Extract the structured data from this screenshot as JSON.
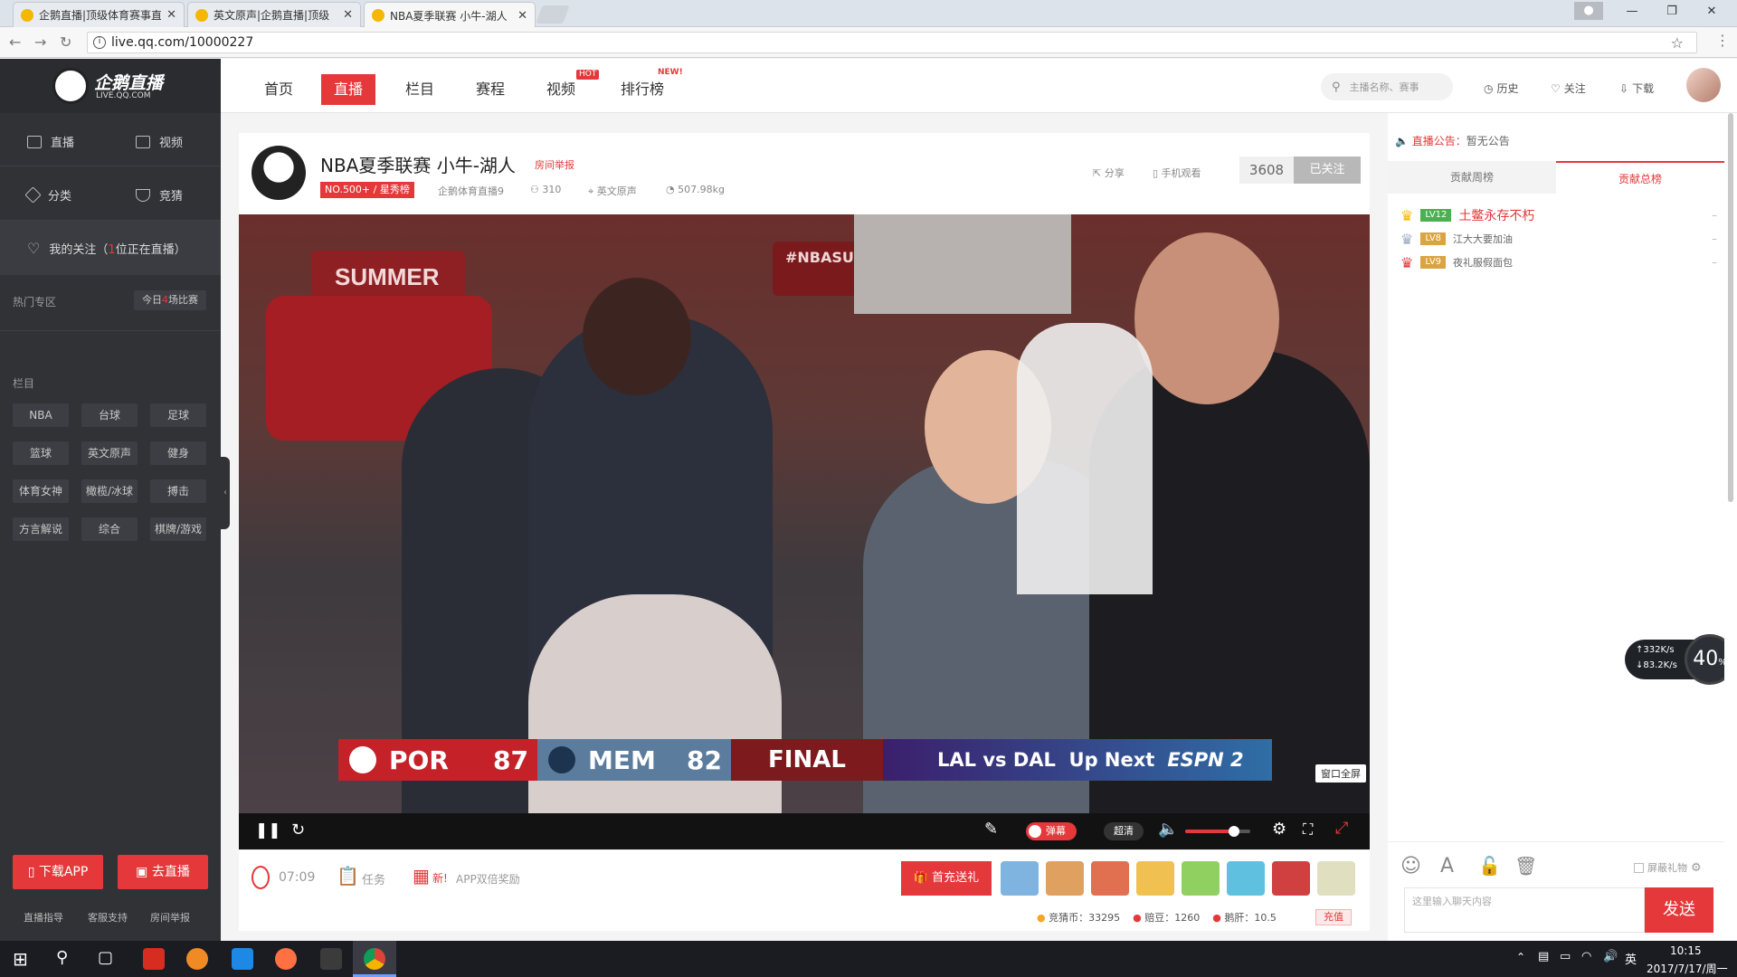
{
  "browser": {
    "tabs": [
      {
        "title": "企鹅直播|顶级体育赛事直"
      },
      {
        "title": "英文原声|企鹅直播|顶级"
      },
      {
        "title": "NBA夏季联赛 小牛-湖人"
      }
    ],
    "url": "live.qq.com/10000227"
  },
  "header": {
    "logo_text": "企鹅直播",
    "logo_sub": "LIVE.QQ.COM",
    "nav": [
      {
        "label": "首页"
      },
      {
        "label": "直播"
      },
      {
        "label": "栏目"
      },
      {
        "label": "赛程"
      },
      {
        "label": "视频"
      },
      {
        "label": "排行榜"
      }
    ],
    "hot_badge": "HOT",
    "new_badge": "NEW!",
    "search_placeholder": "主播名称、赛事",
    "history": "历史",
    "follow": "关注",
    "download": "下载"
  },
  "sidebar": {
    "live": "直播",
    "video": "视频",
    "category": "分类",
    "guess": "竞猜",
    "my_follow": "我的关注（",
    "my_follow_count": "1",
    "my_follow_suffix": "位正在直播）",
    "hot_zone": "热门专区",
    "today_prefix": "今日",
    "today_count": "4",
    "today_suffix": "场比赛",
    "column_title": "栏目",
    "tags": [
      "NBA",
      "台球",
      "足球",
      "篮球",
      "英文原声",
      "健身",
      "体育女神",
      "橄榄/冰球",
      "搏击",
      "方言解说",
      "综合",
      "棋牌/游戏"
    ],
    "download_app": "下载APP",
    "go_live": "去直播",
    "footer": [
      "直播指导",
      "客服支持",
      "房间举报"
    ]
  },
  "room": {
    "title": "NBA夏季联赛 小牛-湖人",
    "report": "房间举报",
    "rank": "NO.500+ / 星秀榜",
    "anchor": "企鹅体育直播9",
    "viewers": "310",
    "category": "英文原声",
    "weight": "507.98kg",
    "share": "分享",
    "mobile_watch": "手机观看",
    "follow_count": "3608",
    "followed": "已关注"
  },
  "scoreboard": {
    "team1": "POR",
    "score1": "87",
    "team2": "MEM",
    "score2": "82",
    "status": "FINAL",
    "upnext": "LAL vs DAL  Up Next",
    "network": "ESPN 2",
    "banner1": "#NBASUMMER",
    "banner2": "SUMMER"
  },
  "player": {
    "window_full": "窗口全屏",
    "danmu": "弹幕",
    "quality": "超清",
    "volume_percent": 75
  },
  "bottom": {
    "time": "07:09",
    "task": "任务",
    "new_label": "新!",
    "app_reward": "APP双倍奖励",
    "recharge_gift": "首充送礼",
    "coins_label": "竞猜币：",
    "coins": "33295",
    "beans_label": "赔豆：",
    "beans": "1260",
    "liver_label": "鹅肝：",
    "liver": "10.5",
    "recharge": "充值"
  },
  "right": {
    "notice_label": "直播公告：",
    "notice": "暂无公告",
    "tab_week": "贡献周榜",
    "tab_total": "贡献总榜",
    "ranks": [
      {
        "level": "LV12",
        "name": "土鳖永存不朽"
      },
      {
        "level": "LV8",
        "name": "江大大要加油"
      },
      {
        "level": "LV9",
        "name": "夜礼服假面包"
      }
    ],
    "speed_up": "332K/s",
    "speed_down": "83.2K/s",
    "percent": "40",
    "block_gift": "屏蔽礼物",
    "chat_placeholder": "这里输入聊天内容",
    "send": "发送"
  },
  "taskbar": {
    "time": "10:15",
    "date": "2017/7/17/周一",
    "ime": "英"
  },
  "colors": {
    "accent": "#e5383b",
    "sidebar": "#303236",
    "player_bar": "#121212"
  }
}
